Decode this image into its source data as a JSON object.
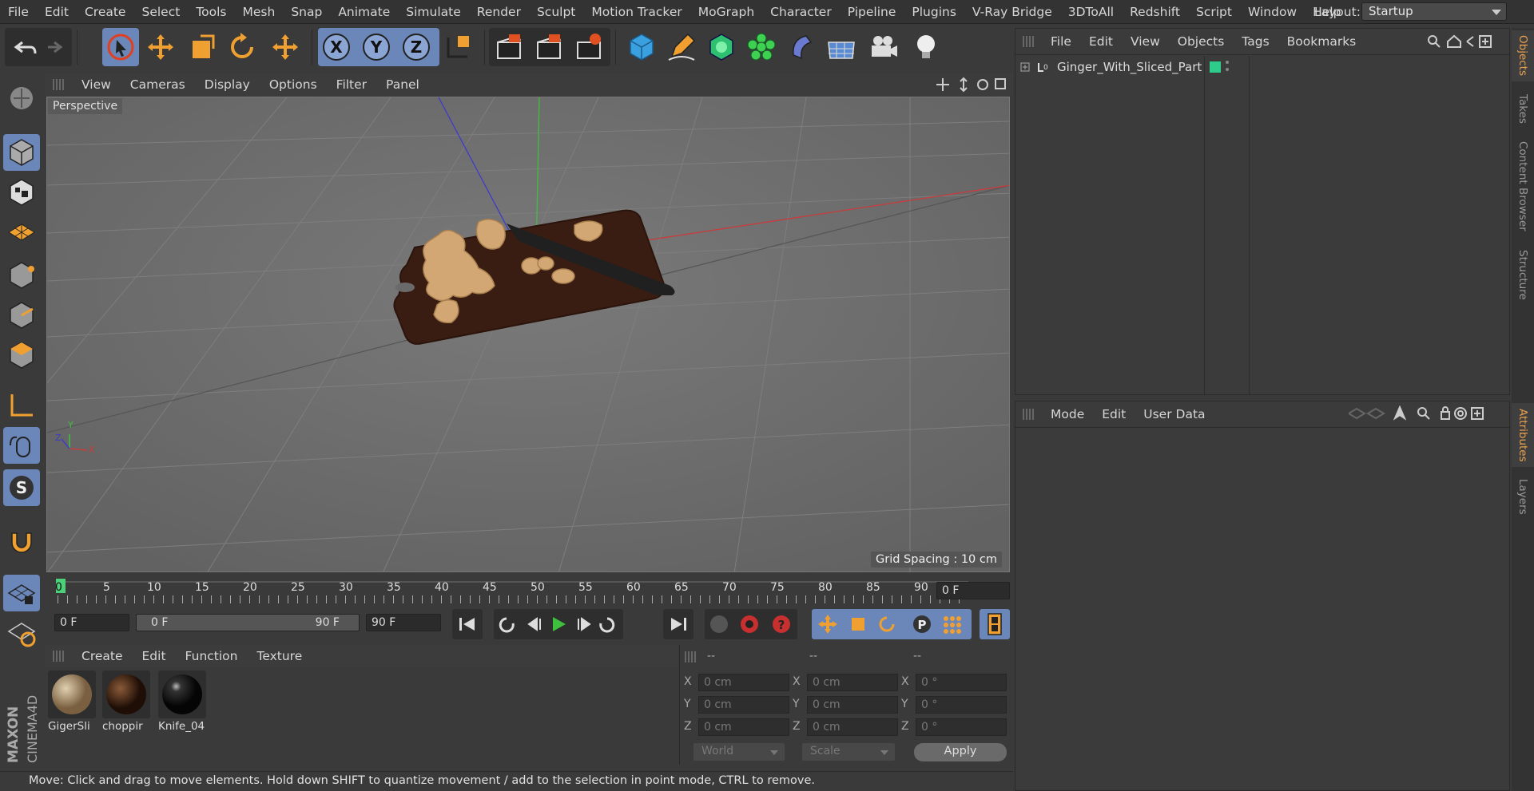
{
  "menubar": {
    "items": [
      "File",
      "Edit",
      "Create",
      "Select",
      "Tools",
      "Mesh",
      "Snap",
      "Animate",
      "Simulate",
      "Render",
      "Sculpt",
      "Motion Tracker",
      "MoGraph",
      "Character",
      "Pipeline",
      "Plugins",
      "V-Ray Bridge",
      "3DToAll",
      "Redshift",
      "Script",
      "Window",
      "Help"
    ],
    "layout_label": "Layout:",
    "layout_value": "Startup"
  },
  "viewport": {
    "menu": [
      "View",
      "Cameras",
      "Display",
      "Options",
      "Filter",
      "Panel"
    ],
    "label": "Perspective",
    "grid_spacing": "Grid Spacing : 10 cm",
    "axis_labels": {
      "x": "X",
      "y": "Y",
      "z": "Z"
    }
  },
  "timeline": {
    "ticks": [
      "0",
      "5",
      "10",
      "15",
      "20",
      "25",
      "30",
      "35",
      "40",
      "45",
      "50",
      "55",
      "60",
      "65",
      "70",
      "75",
      "80",
      "85",
      "90"
    ],
    "current_frame": "0 F",
    "start": "0 F",
    "range_start": "0 F",
    "range_end": "90 F",
    "end": "90 F"
  },
  "materials": {
    "menu": [
      "Create",
      "Edit",
      "Function",
      "Texture"
    ],
    "items": [
      {
        "name": "GigerSli",
        "color": "#b59a72"
      },
      {
        "name": "choppir",
        "color": "#4a2a18"
      },
      {
        "name": "Knife_04",
        "color": "#1a1a1a"
      }
    ]
  },
  "coords": {
    "headers": [
      "--",
      "--",
      "--"
    ],
    "rows": [
      {
        "axis": "X",
        "pos": "0 cm",
        "size": "0 cm",
        "rot": "0 °"
      },
      {
        "axis": "Y",
        "pos": "0 cm",
        "size": "0 cm",
        "rot": "0 °"
      },
      {
        "axis": "Z",
        "pos": "0 cm",
        "size": "0 cm",
        "rot": "0 °"
      }
    ],
    "world": "World",
    "scale": "Scale",
    "apply": "Apply"
  },
  "status": "Move: Click and drag to move elements. Hold down SHIFT to quantize movement / add to the selection in point mode, CTRL to remove.",
  "objects": {
    "menu": [
      "File",
      "Edit",
      "View",
      "Objects",
      "Tags",
      "Bookmarks"
    ],
    "items": [
      {
        "name": "Ginger_With_Sliced_Part",
        "tag_color": "#2ecc8a"
      }
    ]
  },
  "attributes": {
    "menu": [
      "Mode",
      "Edit",
      "User Data"
    ]
  },
  "side_tabs": [
    "Objects",
    "Takes",
    "Content Browser",
    "Structure",
    "Attributes",
    "Layers"
  ],
  "brand": {
    "maxon": "MAXON",
    "product": "CINEMA4D"
  },
  "colors": {
    "accent": "#6b86b8",
    "orange": "#f0a030",
    "green_axis": "#3ec03e",
    "red_axis": "#c83c3c",
    "blue_axis": "#3c3cc8"
  }
}
